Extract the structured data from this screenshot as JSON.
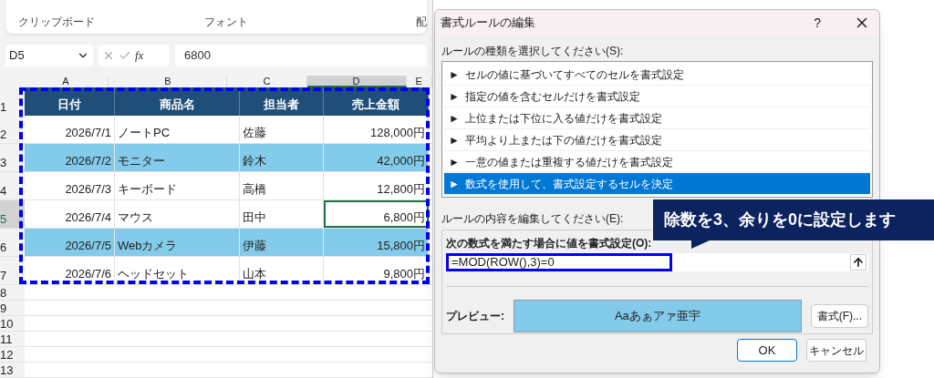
{
  "ribbon": {
    "groups": [
      "クリップボード",
      "フォント",
      "配"
    ]
  },
  "formula_bar": {
    "name_box": "D5",
    "value": "6800",
    "fx": "fx"
  },
  "sheet": {
    "columns": [
      {
        "label": "A",
        "selected": false
      },
      {
        "label": "B",
        "selected": false
      },
      {
        "label": "C",
        "selected": false
      },
      {
        "label": "D",
        "selected": true
      },
      {
        "label": "E",
        "selected": false
      }
    ],
    "header": [
      "日付",
      "商品名",
      "担当者",
      "売上金額"
    ],
    "rows": [
      {
        "num": "2",
        "highlighted": false,
        "selected": false,
        "cells": [
          "2026/7/1",
          "ノートPC",
          "佐藤",
          "128,000円"
        ]
      },
      {
        "num": "3",
        "highlighted": true,
        "selected": false,
        "cells": [
          "2026/7/2",
          "モニター",
          "鈴木",
          "42,000円"
        ]
      },
      {
        "num": "4",
        "highlighted": false,
        "selected": false,
        "cells": [
          "2026/7/3",
          "キーボード",
          "高橋",
          "12,800円"
        ]
      },
      {
        "num": "5",
        "highlighted": false,
        "selected": true,
        "cells": [
          "2026/7/4",
          "マウス",
          "田中",
          "6,800円"
        ]
      },
      {
        "num": "6",
        "highlighted": true,
        "selected": false,
        "cells": [
          "2026/7/5",
          "Webカメラ",
          "伊藤",
          "15,800円"
        ]
      },
      {
        "num": "7",
        "highlighted": false,
        "selected": false,
        "cells": [
          "2026/7/6",
          "ヘッドセット",
          "山本",
          "9,800円"
        ]
      }
    ],
    "header_num": "1",
    "empty_rows": [
      "8",
      "9",
      "10",
      "11",
      "12",
      "13"
    ]
  },
  "dialog": {
    "title": "書式ルールの編集",
    "help": "?",
    "rule_type_label": "ルールの種類を選択してください(S):",
    "rule_types": [
      {
        "label": "セルの値に基づいてすべてのセルを書式設定",
        "selected": false
      },
      {
        "label": "指定の値を含むセルだけを書式設定",
        "selected": false
      },
      {
        "label": "上位または下位に入る値だけを書式設定",
        "selected": false
      },
      {
        "label": "平均より上または下の値だけを書式設定",
        "selected": false
      },
      {
        "label": "一意の値または重複する値だけを書式設定",
        "selected": false
      },
      {
        "label": "数式を使用して、書式設定するセルを決定",
        "selected": true
      }
    ],
    "bullet": "►",
    "edit_label": "ルールの内容を編集してください(E):",
    "formula_label": "次の数式を満たす場合に値を書式設定(O):",
    "formula": "=MOD(ROW(),3)=0",
    "preview_label": "プレビュー:",
    "preview_text": "Aaあぁアァ亜宇",
    "format_button": "書式(F)...",
    "ok": "OK",
    "cancel": "キャンセル"
  },
  "callout": "除数を3、余りを0に設定します"
}
